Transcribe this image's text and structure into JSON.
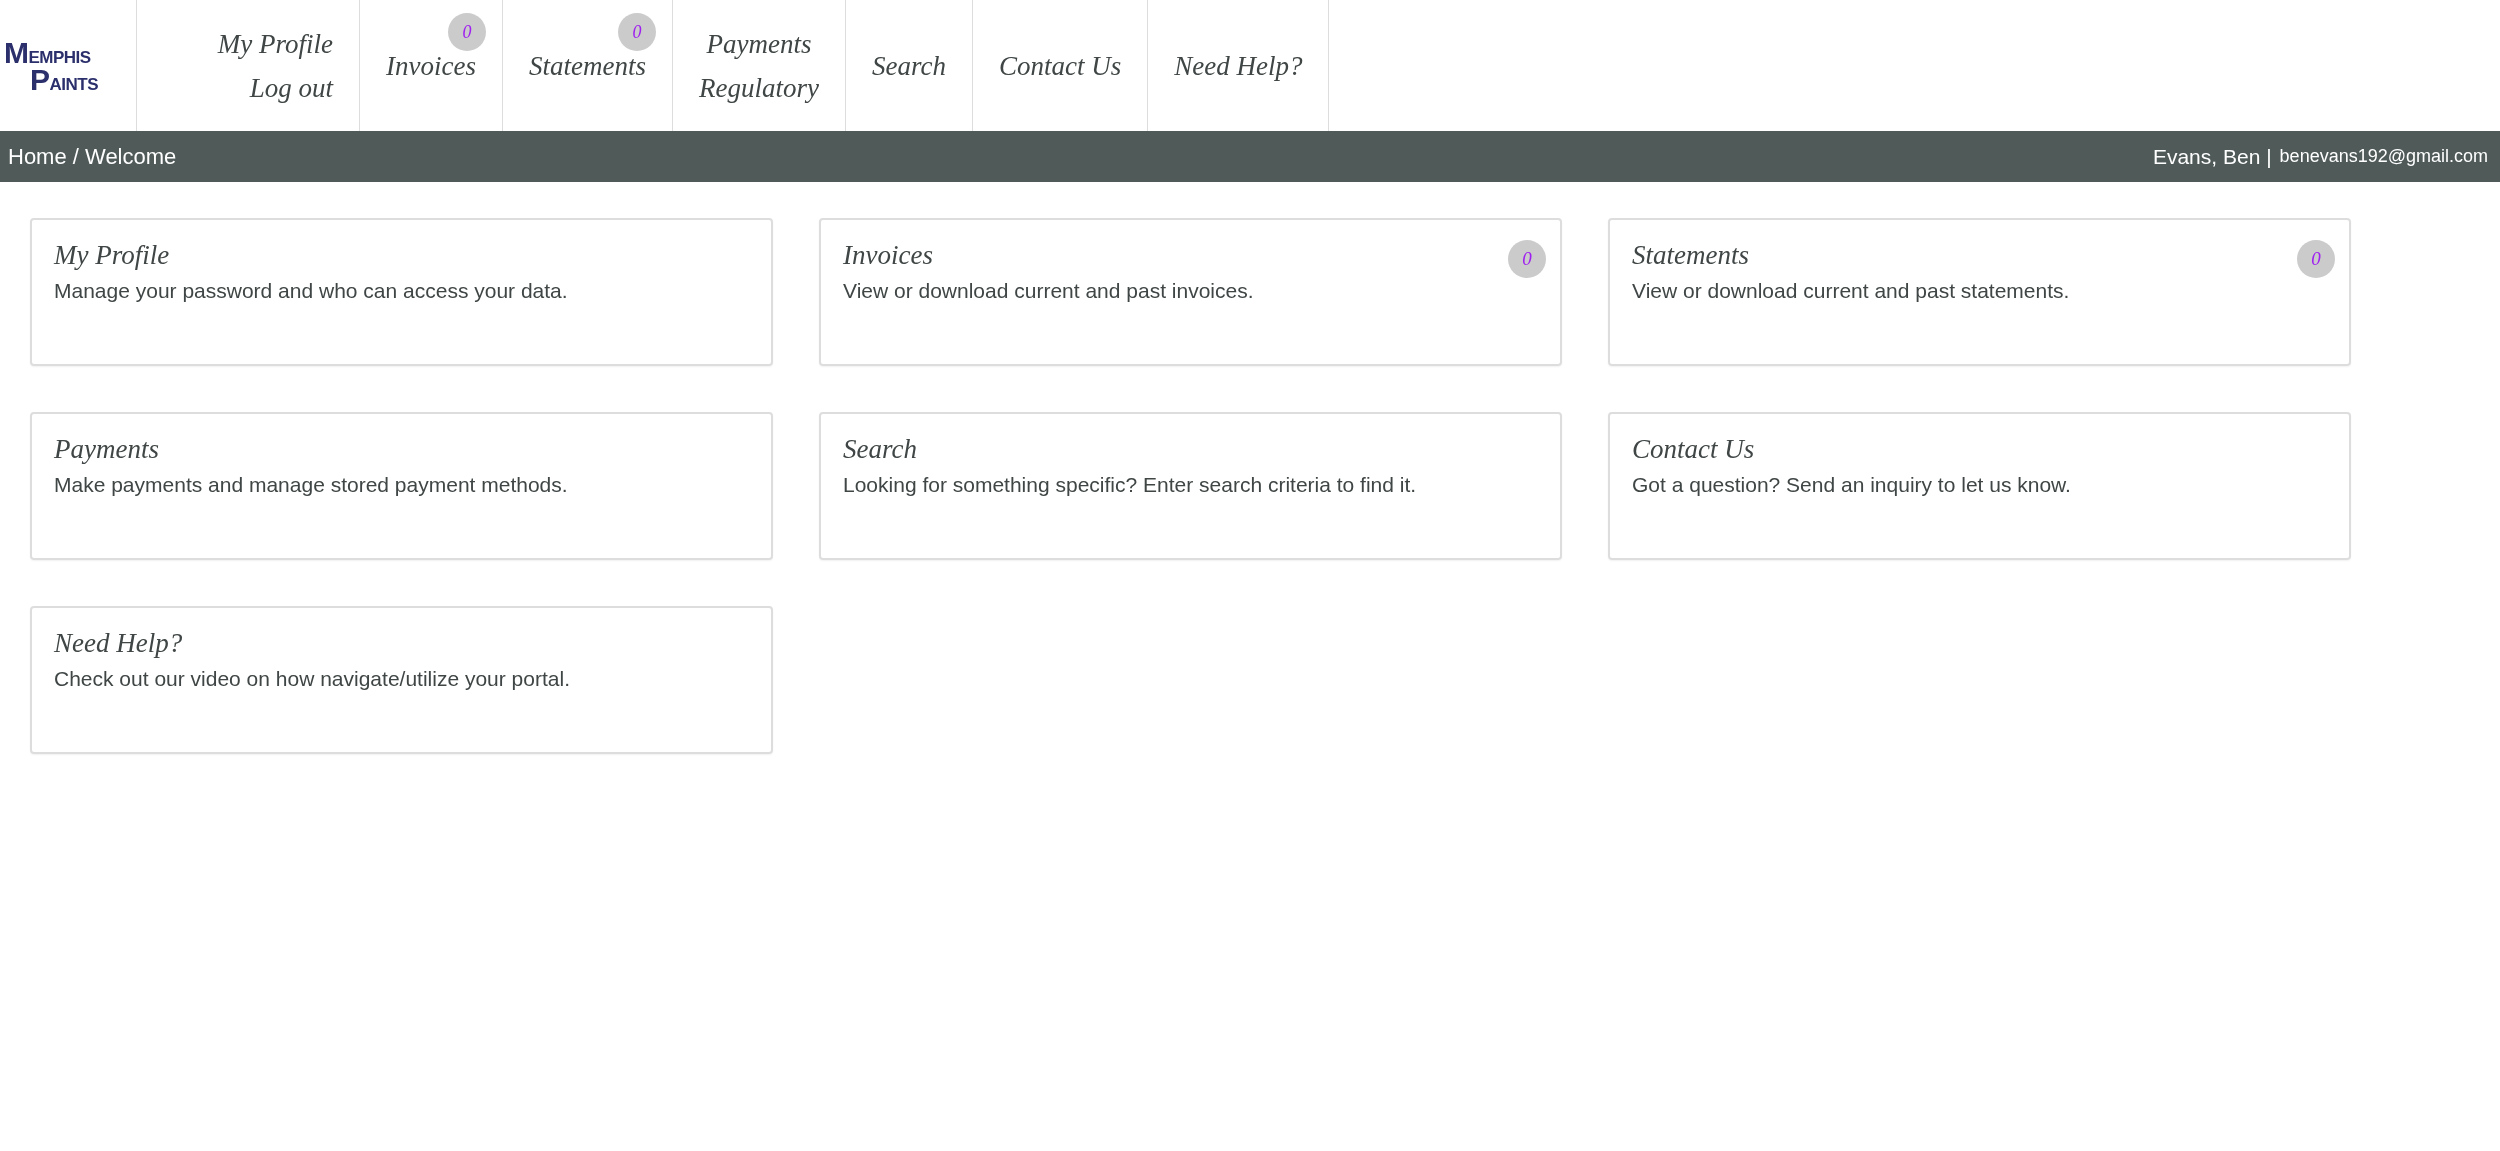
{
  "logo": {
    "words": [
      "MEMPHIS",
      "PAINTS"
    ]
  },
  "nav": [
    {
      "links": [
        "My Profile",
        "Log out"
      ]
    },
    {
      "links": [
        "Invoices"
      ],
      "badge": "0"
    },
    {
      "links": [
        "Statements"
      ],
      "badge": "0"
    },
    {
      "links": [
        "Payments",
        "Regulatory"
      ]
    },
    {
      "links": [
        "Search"
      ]
    },
    {
      "links": [
        "Contact Us"
      ]
    },
    {
      "links": [
        "Need Help?"
      ]
    }
  ],
  "breadcrumb": "Home / Welcome",
  "user": {
    "name": "Evans, Ben |",
    "email": "benevans192@gmail.com"
  },
  "cards": [
    {
      "title": "My Profile",
      "description": "Manage your password and who can access your data."
    },
    {
      "title": "Invoices",
      "description": "View or download current and past invoices.",
      "badge": "0"
    },
    {
      "title": "Statements",
      "description": "View or download current and past statements.",
      "badge": "0"
    },
    {
      "title": "Payments",
      "description": "Make payments and manage stored payment methods."
    },
    {
      "title": "Search",
      "description": "Looking for something specific? Enter search criteria to find it."
    },
    {
      "title": "Contact Us",
      "description": "Got a question? Send an inquiry to let us know."
    },
    {
      "title": "Need Help?",
      "description": "Check out our video on how navigate/utilize your portal."
    }
  ]
}
